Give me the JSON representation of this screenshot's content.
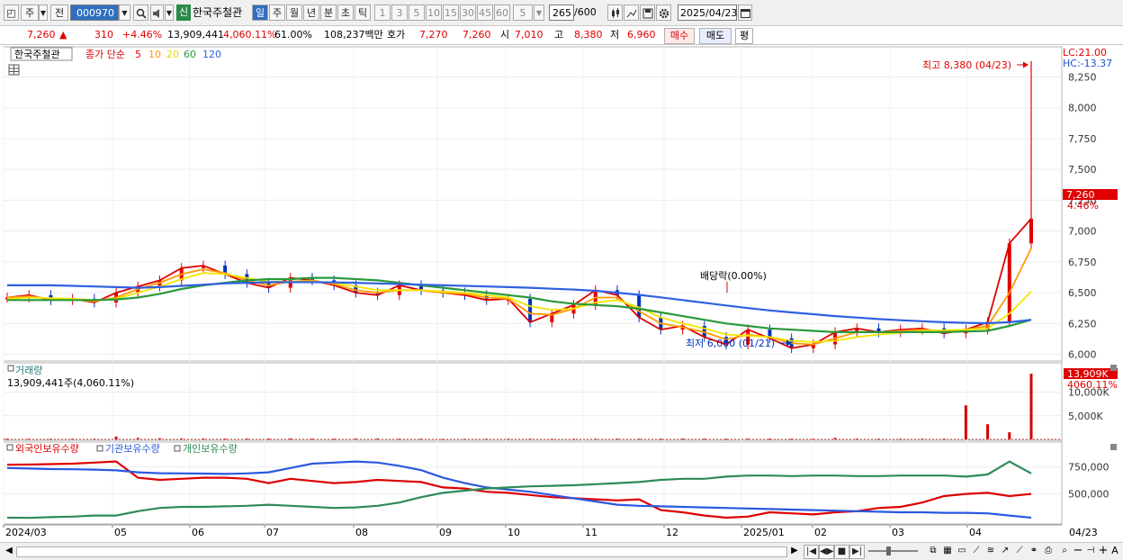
{
  "toolbar": {
    "type_label": "주",
    "prev_label": "전",
    "code_value": "000970",
    "search_icon": "magnifier-icon",
    "sound_icon": "speaker-icon",
    "credit_badge": "신",
    "stock_name": "한국주철관",
    "periods": [
      "일",
      "주",
      "월",
      "년",
      "분",
      "초",
      "틱"
    ],
    "active_period": "일",
    "minute_intervals": [
      "1",
      "3",
      "5",
      "10",
      "15",
      "30",
      "45",
      "60"
    ],
    "custom_interval": "5",
    "count_value": "265",
    "count_total": "/600",
    "date_value": "2025/04/23"
  },
  "quote": {
    "price": "7,260",
    "change_arrow": "▲",
    "change": "310",
    "change_pct": "+4.46%",
    "volume": "13,909,441",
    "volume_ratio": "4,060.11%",
    "turnover_pct": "61.00%",
    "amount": "108,237백만",
    "bid_label": "호가",
    "bid_value": "7,270",
    "ask_value": "7,260",
    "open_label": "시",
    "open_value": "7,010",
    "high_label": "고",
    "high_value": "8,380",
    "low_label": "저",
    "low_value": "6,960",
    "buy_label": "매수",
    "sell_label": "매도",
    "eval_label": "평"
  },
  "colors": {
    "up": "#e00000",
    "down": "#0030c0",
    "ma5": "#e00000",
    "ma10": "#ff9900",
    "ma20": "#f2e600",
    "ma60": "#2a9a3a",
    "ma120": "#3060e0",
    "foreign": "#dd0000",
    "institution": "#2a58e0",
    "individual": "#2e8b57"
  },
  "chart_data": [
    {
      "type": "line",
      "pane": "price",
      "legend": {
        "name": "한국주철관",
        "ma_label": "종가 단순",
        "ma_periods": [
          "5",
          "10",
          "20",
          "60",
          "120"
        ]
      },
      "y_ticks": [
        "8,250",
        "8,000",
        "7,750",
        "7,500",
        "7,250",
        "7,000",
        "6,750",
        "6,500",
        "6,250",
        "6,000"
      ],
      "ylim": [
        5960,
        8480
      ],
      "corner_labels": [
        "LC:21.00",
        "HC:-13.37"
      ],
      "current_tag": "7,260",
      "current_pct": "4.46%",
      "annotations": {
        "high": "최고 8,380 (04/23)",
        "low": "최저 6,000 (01/21)",
        "dividend": "배당락(0.00%)"
      },
      "series": [
        {
          "name": "5",
          "values": [
            6460,
            6480,
            6440,
            6450,
            6420,
            6500,
            6550,
            6600,
            6700,
            6720,
            6650,
            6580,
            6540,
            6620,
            6600,
            6560,
            6500,
            6480,
            6560,
            6520,
            6500,
            6480,
            6440,
            6450,
            6260,
            6330,
            6400,
            6520,
            6480,
            6300,
            6200,
            6230,
            6140,
            6080,
            6200,
            6130,
            6050,
            6080,
            6180,
            6210,
            6180,
            6200,
            6210,
            6170,
            6200,
            6260,
            6900,
            7100
          ]
        },
        {
          "name": "10",
          "values": [
            6460,
            6470,
            6450,
            6445,
            6430,
            6460,
            6530,
            6580,
            6650,
            6690,
            6660,
            6600,
            6560,
            6590,
            6600,
            6570,
            6520,
            6500,
            6520,
            6520,
            6500,
            6490,
            6460,
            6450,
            6330,
            6320,
            6370,
            6460,
            6460,
            6350,
            6250,
            6220,
            6180,
            6120,
            6160,
            6140,
            6090,
            6080,
            6130,
            6180,
            6180,
            6190,
            6200,
            6190,
            6200,
            6230,
            6500,
            6860
          ]
        },
        {
          "name": "20",
          "values": [
            6450,
            6460,
            6455,
            6450,
            6440,
            6450,
            6500,
            6550,
            6610,
            6660,
            6650,
            6620,
            6590,
            6590,
            6590,
            6580,
            6550,
            6520,
            6520,
            6520,
            6510,
            6500,
            6480,
            6460,
            6390,
            6360,
            6370,
            6420,
            6440,
            6380,
            6300,
            6250,
            6210,
            6160,
            6150,
            6140,
            6110,
            6100,
            6110,
            6140,
            6160,
            6175,
            6190,
            6195,
            6200,
            6210,
            6330,
            6510
          ]
        },
        {
          "name": "60",
          "values": [
            6440,
            6440,
            6440,
            6440,
            6440,
            6445,
            6460,
            6490,
            6530,
            6560,
            6580,
            6600,
            6610,
            6610,
            6620,
            6620,
            6610,
            6600,
            6580,
            6560,
            6540,
            6520,
            6500,
            6480,
            6460,
            6430,
            6410,
            6400,
            6390,
            6370,
            6340,
            6310,
            6280,
            6250,
            6230,
            6210,
            6200,
            6190,
            6180,
            6180,
            6180,
            6180,
            6180,
            6180,
            6185,
            6190,
            6230,
            6280
          ]
        },
        {
          "name": "120",
          "values": [
            6560,
            6560,
            6560,
            6555,
            6550,
            6545,
            6540,
            6545,
            6555,
            6565,
            6575,
            6580,
            6585,
            6585,
            6585,
            6583,
            6580,
            6575,
            6570,
            6565,
            6560,
            6555,
            6550,
            6545,
            6540,
            6532,
            6525,
            6515,
            6500,
            6482,
            6462,
            6440,
            6418,
            6396,
            6375,
            6356,
            6340,
            6325,
            6310,
            6298,
            6286,
            6276,
            6268,
            6260,
            6255,
            6252,
            6260,
            6280
          ]
        }
      ]
    },
    {
      "type": "bar",
      "pane": "volume",
      "title": "거래량",
      "readout": "13,909,441주(4,060.11%)",
      "y_ticks": [
        "10,000K",
        "5,000K"
      ],
      "ylim": [
        0,
        14500000
      ],
      "current_tag": "13,909K",
      "current_pct": "4060.11%",
      "values": [
        150000,
        130000,
        120000,
        160000,
        140000,
        600000,
        300000,
        250000,
        200000,
        180000,
        160000,
        150000,
        170000,
        190000,
        140000,
        130000,
        150000,
        160000,
        140000,
        130000,
        120000,
        110000,
        130000,
        140000,
        150000,
        120000,
        110000,
        130000,
        160000,
        140000,
        120000,
        150000,
        130000,
        120000,
        140000,
        130000,
        120000,
        110000,
        300000,
        150000,
        140000,
        130000,
        150000,
        160000,
        7200000,
        3200000,
        1500000,
        13909441
      ]
    },
    {
      "type": "line",
      "pane": "holdings",
      "legend": [
        "외국인보유수량",
        "기관보유수량",
        "개인보유수량"
      ],
      "y_ticks": [
        "750,000",
        "500,000"
      ],
      "ylim": [
        230000,
        880000
      ],
      "current_tag": "",
      "series": [
        {
          "name": "외국인보유수량",
          "values": [
            770000,
            772000,
            776000,
            780000,
            790000,
            800000,
            650000,
            630000,
            640000,
            650000,
            650000,
            640000,
            600000,
            640000,
            620000,
            600000,
            610000,
            630000,
            620000,
            610000,
            560000,
            550000,
            520000,
            510000,
            490000,
            470000,
            460000,
            450000,
            440000,
            450000,
            350000,
            330000,
            300000,
            280000,
            290000,
            330000,
            320000,
            310000,
            330000,
            340000,
            370000,
            380000,
            420000,
            480000,
            500000,
            510000,
            480000,
            500000
          ]
        },
        {
          "name": "기관보유수량",
          "values": [
            740000,
            735000,
            730000,
            728000,
            725000,
            718000,
            700000,
            692000,
            690000,
            688000,
            685000,
            690000,
            700000,
            740000,
            780000,
            790000,
            800000,
            790000,
            760000,
            720000,
            650000,
            600000,
            560000,
            540000,
            520000,
            490000,
            460000,
            430000,
            400000,
            390000,
            385000,
            380000,
            375000,
            370000,
            365000,
            360000,
            355000,
            350000,
            345000,
            340000,
            335000,
            330000,
            330000,
            325000,
            325000,
            320000,
            300000,
            280000
          ]
        },
        {
          "name": "개인보유수량",
          "values": [
            280000,
            278000,
            285000,
            290000,
            300000,
            300000,
            340000,
            370000,
            380000,
            380000,
            385000,
            390000,
            400000,
            390000,
            380000,
            370000,
            375000,
            390000,
            420000,
            470000,
            510000,
            530000,
            550000,
            560000,
            570000,
            575000,
            580000,
            590000,
            600000,
            610000,
            630000,
            640000,
            640000,
            660000,
            670000,
            670000,
            665000,
            670000,
            670000,
            665000,
            665000,
            670000,
            670000,
            670000,
            660000,
            680000,
            800000,
            690000
          ]
        }
      ]
    }
  ],
  "x_axis": {
    "labels": [
      "2024/03",
      "05",
      "06",
      "07",
      "08",
      "09",
      "10",
      "11",
      "12",
      "2025/01",
      "02",
      "03",
      "04"
    ],
    "right_label": "04/23"
  },
  "scrollbar": {
    "left_arrow": "◀",
    "right_arrow": "▶",
    "first": "|◀",
    "prev": "◀▶",
    "stop": "■",
    "next": "▶|",
    "zoom_minus": "−",
    "zoom_plus": "+",
    "font_label": "A"
  }
}
